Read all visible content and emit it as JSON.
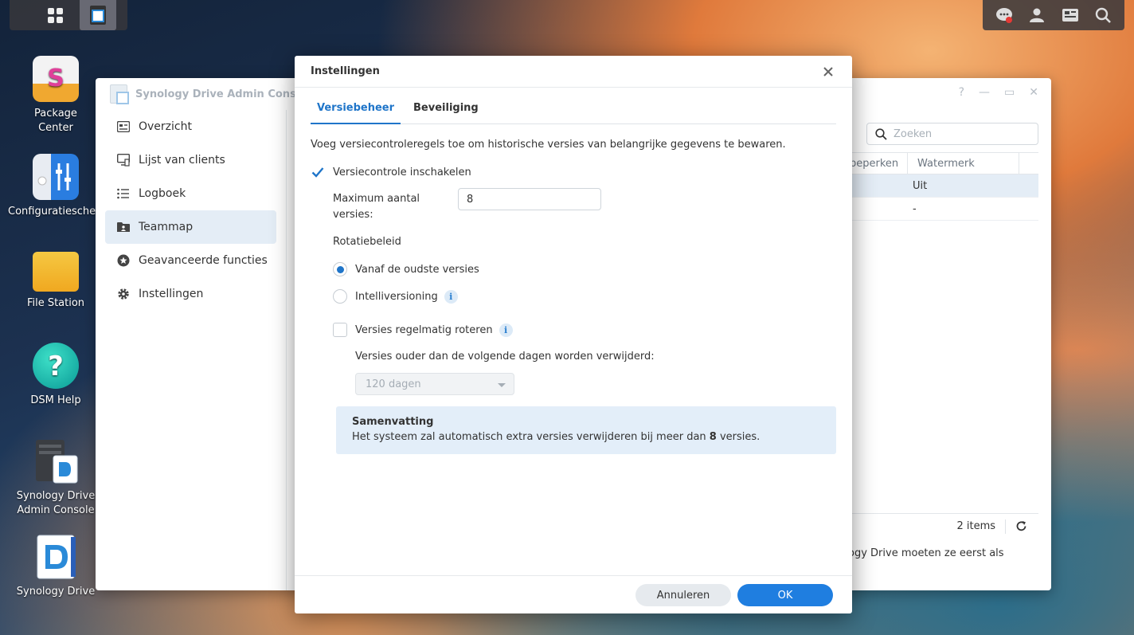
{
  "desktop": {
    "icons": [
      {
        "label": "Package Center",
        "lines": [
          "Package",
          "Center"
        ]
      },
      {
        "label": "Configuratiescherm",
        "lines": [
          "Configuratiescherm",
          ""
        ]
      },
      {
        "label": "File Station",
        "lines": [
          "File Station",
          ""
        ]
      },
      {
        "label": "DSM Help",
        "lines": [
          "DSM Help",
          ""
        ]
      },
      {
        "label": "Synology Drive Admin Console",
        "lines": [
          "Synology Drive",
          "Admin Console"
        ]
      },
      {
        "label": "Synology Drive",
        "lines": [
          "Synology Drive",
          ""
        ]
      }
    ]
  },
  "taskbar": {
    "left_icons": [
      "main-menu-icon",
      "synology-drive-admin-icon"
    ],
    "right_icons": [
      "notifications-icon",
      "user-icon",
      "widgets-icon",
      "search-icon"
    ]
  },
  "admin_window": {
    "title": "Synology Drive Admin Console",
    "sidebar": [
      {
        "label": "Overzicht",
        "icon": "overview-icon"
      },
      {
        "label": "Lijst van clients",
        "icon": "clients-icon"
      },
      {
        "label": "Logboek",
        "icon": "log-icon"
      },
      {
        "label": "Teammap",
        "icon": "team-folder-icon",
        "active": true
      },
      {
        "label": "Geavanceerde functies",
        "icon": "advanced-icon"
      },
      {
        "label": "Instellingen",
        "icon": "settings-icon"
      }
    ],
    "search_placeholder": "Zoeken",
    "columns": [
      "beperken",
      "Watermerk"
    ],
    "rows": [
      "Uit",
      "-"
    ],
    "items_count": "2 items",
    "bottom_note": "ogy Drive moeten ze eerst als"
  },
  "dialog": {
    "title": "Instellingen",
    "tabs": [
      "Versiebeheer",
      "Beveiliging"
    ],
    "active_tab": "Versiebeheer",
    "description": "Voeg versiecontroleregels toe om historische versies van belangrijke gegevens te bewaren.",
    "enable_versioning": {
      "label": "Versiecontrole inschakelen",
      "checked": true
    },
    "max_versions": {
      "label": "Maximum aantal versies:",
      "value": "8"
    },
    "rotation": {
      "label": "Rotatiebeleid",
      "options": [
        {
          "label": "Vanaf de oudste versies",
          "selected": true
        },
        {
          "label": "Intelliversioning",
          "selected": false
        }
      ]
    },
    "rotate_periodically": {
      "label": "Versies regelmatig roteren",
      "checked": false
    },
    "days_label": "Versies ouder dan de volgende dagen worden verwijderd:",
    "days_select": "120 dagen",
    "summary": {
      "title": "Samenvatting",
      "text_before": "Het systeem zal automatisch extra versies verwijderen bij meer dan ",
      "value": "8",
      "text_after": " versies."
    },
    "buttons": {
      "cancel": "Annuleren",
      "ok": "OK"
    }
  },
  "colors": {
    "accent": "#1f75c9",
    "active_bg": "#e4edf6",
    "summary_bg": "#e3eef9"
  }
}
